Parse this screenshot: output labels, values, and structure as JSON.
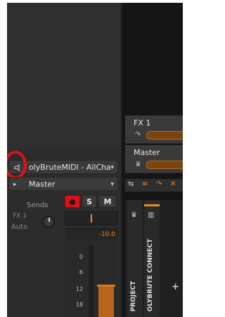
{
  "inspector": {
    "midi_track": {
      "name": "olyBruteMIDI - AllCha",
      "arrow": "▾"
    },
    "output": {
      "name": "Master",
      "arrow": "▾",
      "lead_arrow": "▸"
    },
    "sends": {
      "label": "Sends",
      "fx_name": "FX 1",
      "mode": "Auto"
    },
    "buttons": {
      "solo": "S",
      "mute": "M"
    },
    "volume_db": "-10.0",
    "meter_scale": [
      "0",
      "6",
      "12",
      "18"
    ],
    "highlight_color": "#e0101a",
    "accent_color": "#f08a24"
  },
  "tracks": {
    "fx": {
      "name": "FX 1",
      "icon": "↷"
    },
    "master": {
      "name": "Master",
      "icon": "♛"
    }
  },
  "toolbar": {
    "icons": [
      "⇆",
      "≡",
      "↷",
      "✕"
    ]
  },
  "tabs": {
    "project": {
      "label": "PROJECT",
      "icon": "♛"
    },
    "device": {
      "label": "OLYBRUTE CONNECT",
      "icon": "▥"
    },
    "add": "+"
  }
}
